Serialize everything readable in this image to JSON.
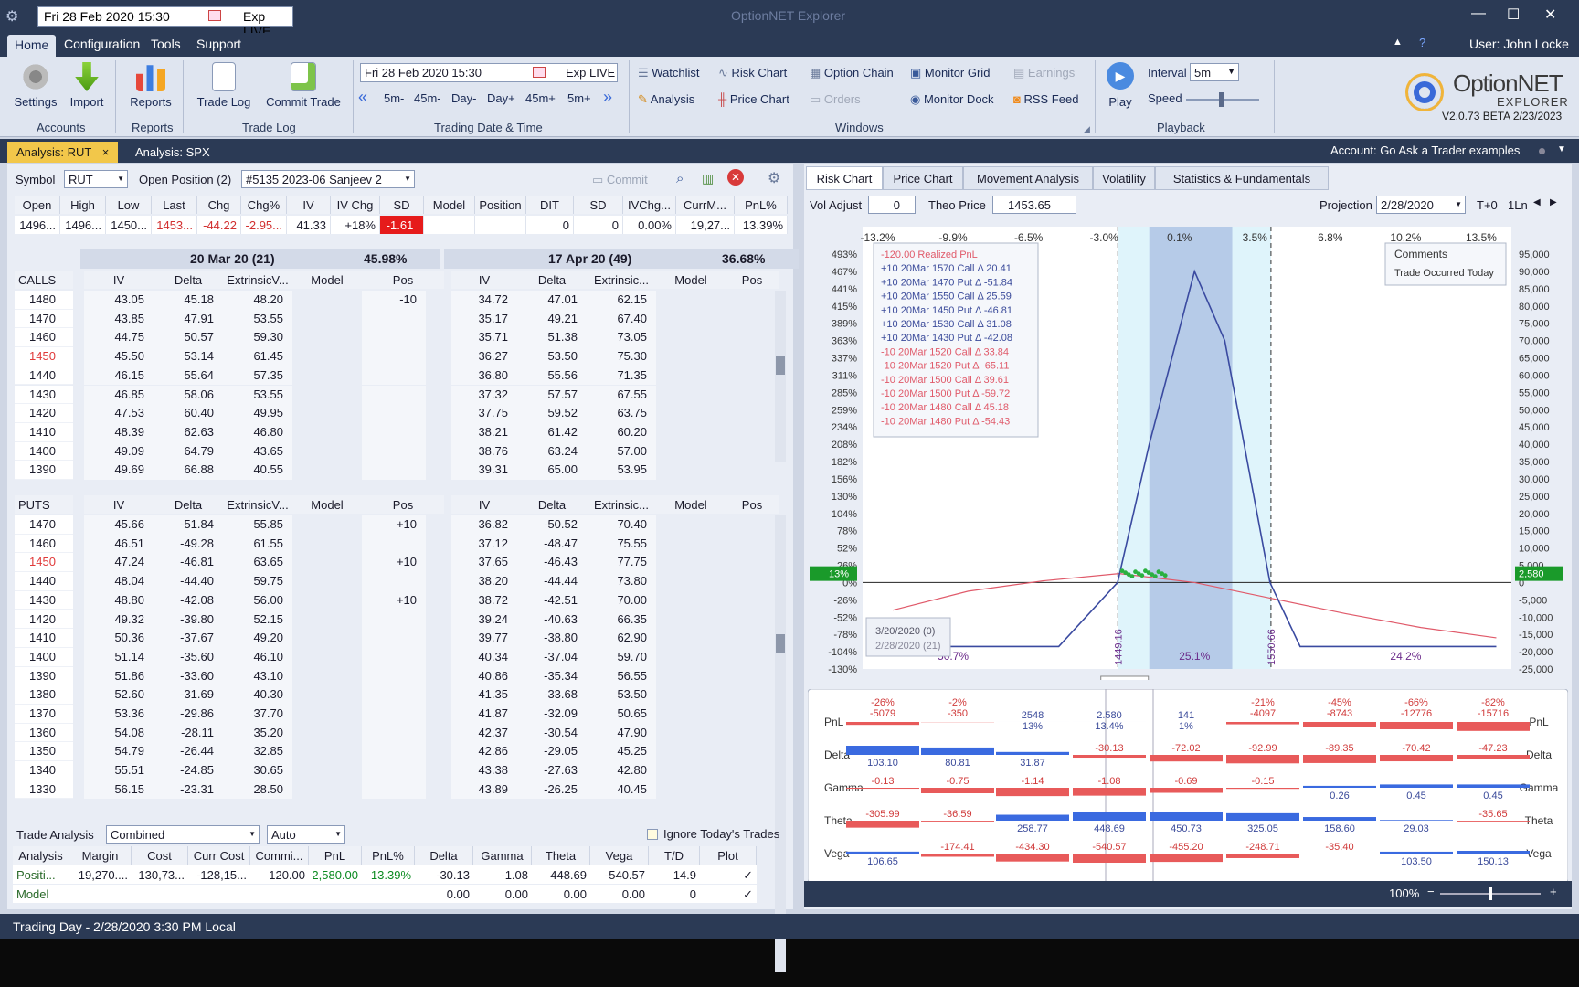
{
  "titlebar": {
    "date": "Fri 28 Feb 2020 15:30",
    "exp": "Exp LIVE",
    "app_title": "OptionNET Explorer"
  },
  "menu": {
    "tabs": [
      "Home",
      "Configuration",
      "Tools",
      "Support"
    ],
    "user": "User: John Locke"
  },
  "ribbon": {
    "settings": "Settings",
    "import": "Import",
    "reports": "Reports",
    "trade_log": "Trade Log",
    "commit_trade": "Commit Trade",
    "group_accounts": "Accounts",
    "group_reports": "Reports",
    "group_tradelog": "Trade Log",
    "group_trading": "Trading Date & Time",
    "group_windows": "Windows",
    "group_playback": "Playback",
    "date": "Fri 28 Feb 2020 15:30",
    "exp": "Exp LIVE",
    "steps": [
      "5m-",
      "45m-",
      "Day-",
      "Day+",
      "45m+",
      "5m+"
    ],
    "win": [
      "Watchlist",
      "Risk Chart",
      "Option Chain",
      "Monitor Grid",
      "Earnings",
      "Analysis",
      "Price Chart",
      "Orders",
      "Monitor Dock",
      "RSS Feed"
    ],
    "play": "Play",
    "interval_label": "Interval",
    "interval": "5m",
    "speed": "Speed",
    "logo1": "OptionNET",
    "logo2": "EXPLORER",
    "version": "V2.0.73 BETA 2/23/2023"
  },
  "doctabs": {
    "t1": "Analysis: RUT",
    "t2": "Analysis: SPX",
    "close": "×",
    "account": "Account: Go Ask a Trader examples"
  },
  "symbolbar": {
    "symbol_label": "Symbol",
    "symbol": "RUT",
    "open_pos_label": "Open Position (2)",
    "position": "#5135 2023-06 Sanjeev 2",
    "commit": "Commit"
  },
  "quote": {
    "headers": [
      "Open",
      "High",
      "Low",
      "Last",
      "Chg",
      "Chg%",
      "IV",
      "IV Chg",
      "SD",
      "Model",
      "Position"
    ],
    "values": [
      "1496...",
      "1496...",
      "1450...",
      "1453...",
      "-44.22",
      "-2.95...",
      "41.33",
      "+18%",
      "-1.61",
      "",
      ""
    ],
    "headers2": [
      "DIT",
      "SD",
      "IVChg...",
      "CurrM...",
      "PnL%"
    ],
    "values2": [
      "0",
      "0",
      "0.00%",
      "19,27...",
      "13.39%"
    ]
  },
  "exp1": {
    "label": "20 Mar 20 (21)",
    "pct": "45.98%"
  },
  "exp2": {
    "label": "17 Apr 20 (49)",
    "pct": "36.68%"
  },
  "chain_cols": [
    "IV",
    "Delta",
    "ExtrinsicV...",
    "Model",
    "Pos"
  ],
  "chain_cols2": [
    "IV",
    "Delta",
    "Extrinsic...",
    "Model",
    "Pos"
  ],
  "calls": {
    "label": "CALLS",
    "rows": [
      [
        "1480",
        "43.05",
        "45.18",
        "48.20",
        "",
        "-10",
        "34.72",
        "47.01",
        "62.15"
      ],
      [
        "1470",
        "43.85",
        "47.91",
        "53.55",
        "",
        "",
        "35.17",
        "49.21",
        "67.40"
      ],
      [
        "1460",
        "44.75",
        "50.57",
        "59.30",
        "",
        "",
        "35.71",
        "51.38",
        "73.05"
      ],
      [
        "1450",
        "45.50",
        "53.14",
        "61.45",
        "",
        "",
        "36.27",
        "53.50",
        "75.30"
      ],
      [
        "1440",
        "46.15",
        "55.64",
        "57.35",
        "",
        "",
        "36.80",
        "55.56",
        "71.35"
      ],
      [
        "1430",
        "46.85",
        "58.06",
        "53.55",
        "",
        "",
        "37.32",
        "57.57",
        "67.55"
      ],
      [
        "1420",
        "47.53",
        "60.40",
        "49.95",
        "",
        "",
        "37.75",
        "59.52",
        "63.75"
      ],
      [
        "1410",
        "48.39",
        "62.63",
        "46.80",
        "",
        "",
        "38.21",
        "61.42",
        "60.20"
      ],
      [
        "1400",
        "49.09",
        "64.79",
        "43.65",
        "",
        "",
        "38.76",
        "63.24",
        "57.00"
      ],
      [
        "1390",
        "49.69",
        "66.88",
        "40.55",
        "",
        "",
        "39.31",
        "65.00",
        "53.95"
      ]
    ]
  },
  "puts": {
    "label": "PUTS",
    "rows": [
      [
        "1470",
        "45.66",
        "-51.84",
        "55.85",
        "",
        "+10",
        "36.82",
        "-50.52",
        "70.40"
      ],
      [
        "1460",
        "46.51",
        "-49.28",
        "61.55",
        "",
        "",
        "37.12",
        "-48.47",
        "75.55"
      ],
      [
        "1450",
        "47.24",
        "-46.81",
        "63.65",
        "",
        "+10",
        "37.65",
        "-46.43",
        "77.75"
      ],
      [
        "1440",
        "48.04",
        "-44.40",
        "59.75",
        "",
        "",
        "38.20",
        "-44.44",
        "73.80"
      ],
      [
        "1430",
        "48.80",
        "-42.08",
        "56.00",
        "",
        "+10",
        "38.72",
        "-42.51",
        "70.00"
      ],
      [
        "1420",
        "49.32",
        "-39.80",
        "52.15",
        "",
        "",
        "39.24",
        "-40.63",
        "66.35"
      ],
      [
        "1410",
        "50.36",
        "-37.67",
        "49.20",
        "",
        "",
        "39.77",
        "-38.80",
        "62.90"
      ],
      [
        "1400",
        "51.14",
        "-35.60",
        "46.10",
        "",
        "",
        "40.34",
        "-37.04",
        "59.70"
      ],
      [
        "1390",
        "51.86",
        "-33.60",
        "43.10",
        "",
        "",
        "40.86",
        "-35.34",
        "56.55"
      ],
      [
        "1380",
        "52.60",
        "-31.69",
        "40.30",
        "",
        "",
        "41.35",
        "-33.68",
        "53.50"
      ],
      [
        "1370",
        "53.36",
        "-29.86",
        "37.70",
        "",
        "",
        "41.87",
        "-32.09",
        "50.65"
      ],
      [
        "1360",
        "54.08",
        "-28.11",
        "35.20",
        "",
        "",
        "42.37",
        "-30.54",
        "47.90"
      ],
      [
        "1350",
        "54.79",
        "-26.44",
        "32.85",
        "",
        "",
        "42.86",
        "-29.05",
        "45.25"
      ],
      [
        "1340",
        "55.51",
        "-24.85",
        "30.65",
        "",
        "",
        "43.38",
        "-27.63",
        "42.80"
      ],
      [
        "1330",
        "56.15",
        "-23.31",
        "28.50",
        "",
        "",
        "43.89",
        "-26.25",
        "40.45"
      ]
    ]
  },
  "trade_analysis": {
    "label": "Trade Analysis",
    "mode": "Combined",
    "auto": "Auto",
    "ignore": "Ignore Today's Trades",
    "headers": [
      "Analysis",
      "Margin",
      "Cost",
      "Curr Cost",
      "Commi...",
      "PnL",
      "PnL%",
      "Delta",
      "Gamma",
      "Theta",
      "Vega",
      "T/D",
      "Plot"
    ],
    "row1": [
      "Positi...",
      "19,270....",
      "130,73...",
      "-128,15...",
      "120.00",
      "2,580.00",
      "13.39%",
      "-30.13",
      "-1.08",
      "448.69",
      "-540.57",
      "14.9",
      "✓"
    ],
    "row2": [
      "Model",
      "",
      "",
      "",
      "",
      "",
      "",
      "0.00",
      "0.00",
      "0.00",
      "0.00",
      "0",
      "✓"
    ]
  },
  "right_tabs": [
    "Risk Chart",
    "Price Chart",
    "Movement Analysis",
    "Volatility",
    "Statistics & Fundamentals"
  ],
  "riskbar": {
    "vol_label": "Vol Adjust",
    "vol": "0",
    "theo_label": "Theo Price",
    "theo": "1453.65",
    "proj_label": "Projection",
    "proj": "2/28/2020",
    "t0": "T+0",
    "ln": "1Ln"
  },
  "chart_data": {
    "type": "line",
    "x_ticks": [
      "1300",
      "1350",
      "1400",
      "1450",
      "1500",
      "1550",
      "1600",
      "1650",
      "1700"
    ],
    "x_current": "1453.65",
    "top_pct": [
      "-13.2%",
      "-9.9%",
      "-6.5%",
      "-3.0%",
      "0.1%",
      "3.5%",
      "6.8%",
      "10.2%",
      "13.5%"
    ],
    "y_left": [
      "493%",
      "467%",
      "441%",
      "415%",
      "389%",
      "363%",
      "337%",
      "311%",
      "285%",
      "259%",
      "234%",
      "208%",
      "182%",
      "156%",
      "130%",
      "104%",
      "78%",
      "52%",
      "26%",
      "13%",
      "0%",
      "-26%",
      "-52%",
      "-78%",
      "-104%",
      "-130%"
    ],
    "y_right": [
      "95,000",
      "90,000",
      "85,000",
      "80,000",
      "75,000",
      "70,000",
      "65,000",
      "60,000",
      "55,000",
      "50,000",
      "45,000",
      "40,000",
      "35,000",
      "30,000",
      "25,000",
      "20,000",
      "15,000",
      "10,000",
      "5,000",
      "2,580",
      "0",
      "-5,000",
      "-10,000",
      "-15,000",
      "-20,000",
      "-25,000"
    ],
    "expiration_curve": [
      [
        1300,
        -18500
      ],
      [
        1410,
        -18500
      ],
      [
        1449,
        0
      ],
      [
        1470,
        40000
      ],
      [
        1500,
        90000
      ],
      [
        1520,
        70000
      ],
      [
        1550,
        0
      ],
      [
        1570,
        -18500
      ],
      [
        1700,
        -18500
      ]
    ],
    "t0_curve": [
      [
        1300,
        -8000
      ],
      [
        1350,
        -2500
      ],
      [
        1400,
        500
      ],
      [
        1450,
        2580
      ],
      [
        1500,
        0
      ],
      [
        1550,
        -4500
      ],
      [
        1600,
        -9000
      ],
      [
        1650,
        -13000
      ],
      [
        1700,
        -16000
      ]
    ],
    "vlines": [
      "1449.16",
      "1550.66"
    ],
    "bottom_pct": [
      "50.7%",
      "25.1%",
      "24.2%"
    ],
    "legend": [
      "-120.00 Realized PnL",
      "+10 20Mar 1570 Call Δ  20.41",
      "+10 20Mar 1470 Put Δ  -51.84",
      "+10 20Mar 1550 Call Δ  25.59",
      "+10 20Mar 1450 Put Δ  -46.81",
      "+10 20Mar 1530 Call Δ  31.08",
      "+10 20Mar 1430 Put Δ  -42.08",
      "-10 20Mar 1520 Call Δ  33.84",
      "-10 20Mar 1520 Put Δ  -65.11",
      "-10 20Mar 1500 Call Δ  39.61",
      "-10 20Mar 1500 Put Δ  -59.72",
      "-10 20Mar 1480 Call Δ  45.18",
      "-10 20Mar 1480 Put Δ  -54.43"
    ],
    "comments": "Comments",
    "comments_text": "Trade Occurred Today",
    "date_box": [
      "3/20/2020 (0)",
      "2/28/2020 (21)"
    ],
    "badge_left": "13%",
    "badge_right": "2,580"
  },
  "greeks": {
    "labels": [
      "PnL",
      "Delta",
      "Gamma",
      "Theta",
      "Vega"
    ],
    "pnl": [
      "-26%",
      "-5079",
      "-2%",
      "-350",
      "2548",
      "13%",
      "2.580",
      "13.4%",
      "141",
      "1%",
      "-21%",
      "-4097",
      "-45%",
      "-8743",
      "-66%",
      "-12776",
      "-82%",
      "-15716"
    ],
    "delta": [
      "103.10",
      "80.81",
      "31.87",
      "-30.13",
      "-72.02",
      "-92.99",
      "-89.35",
      "-70.42",
      "-47.23"
    ],
    "gamma": [
      "-0.13",
      "-0.75",
      "-1.14",
      "-1.08",
      "-0.69",
      "-0.15",
      "0.26",
      "0.45",
      "0.45"
    ],
    "theta": [
      "-305.99",
      "-36.59",
      "258.77",
      "448.69",
      "450.73",
      "325.05",
      "158.60",
      "29.03",
      "-35.65"
    ],
    "vega": [
      "106.65",
      "-174.41",
      "-434.30",
      "-540.57",
      "-455.20",
      "-248.71",
      "-35.40",
      "103.50",
      "150.13"
    ]
  },
  "zoom": "100%",
  "status": "Trading Day - 2/28/2020 3:30 PM Local"
}
